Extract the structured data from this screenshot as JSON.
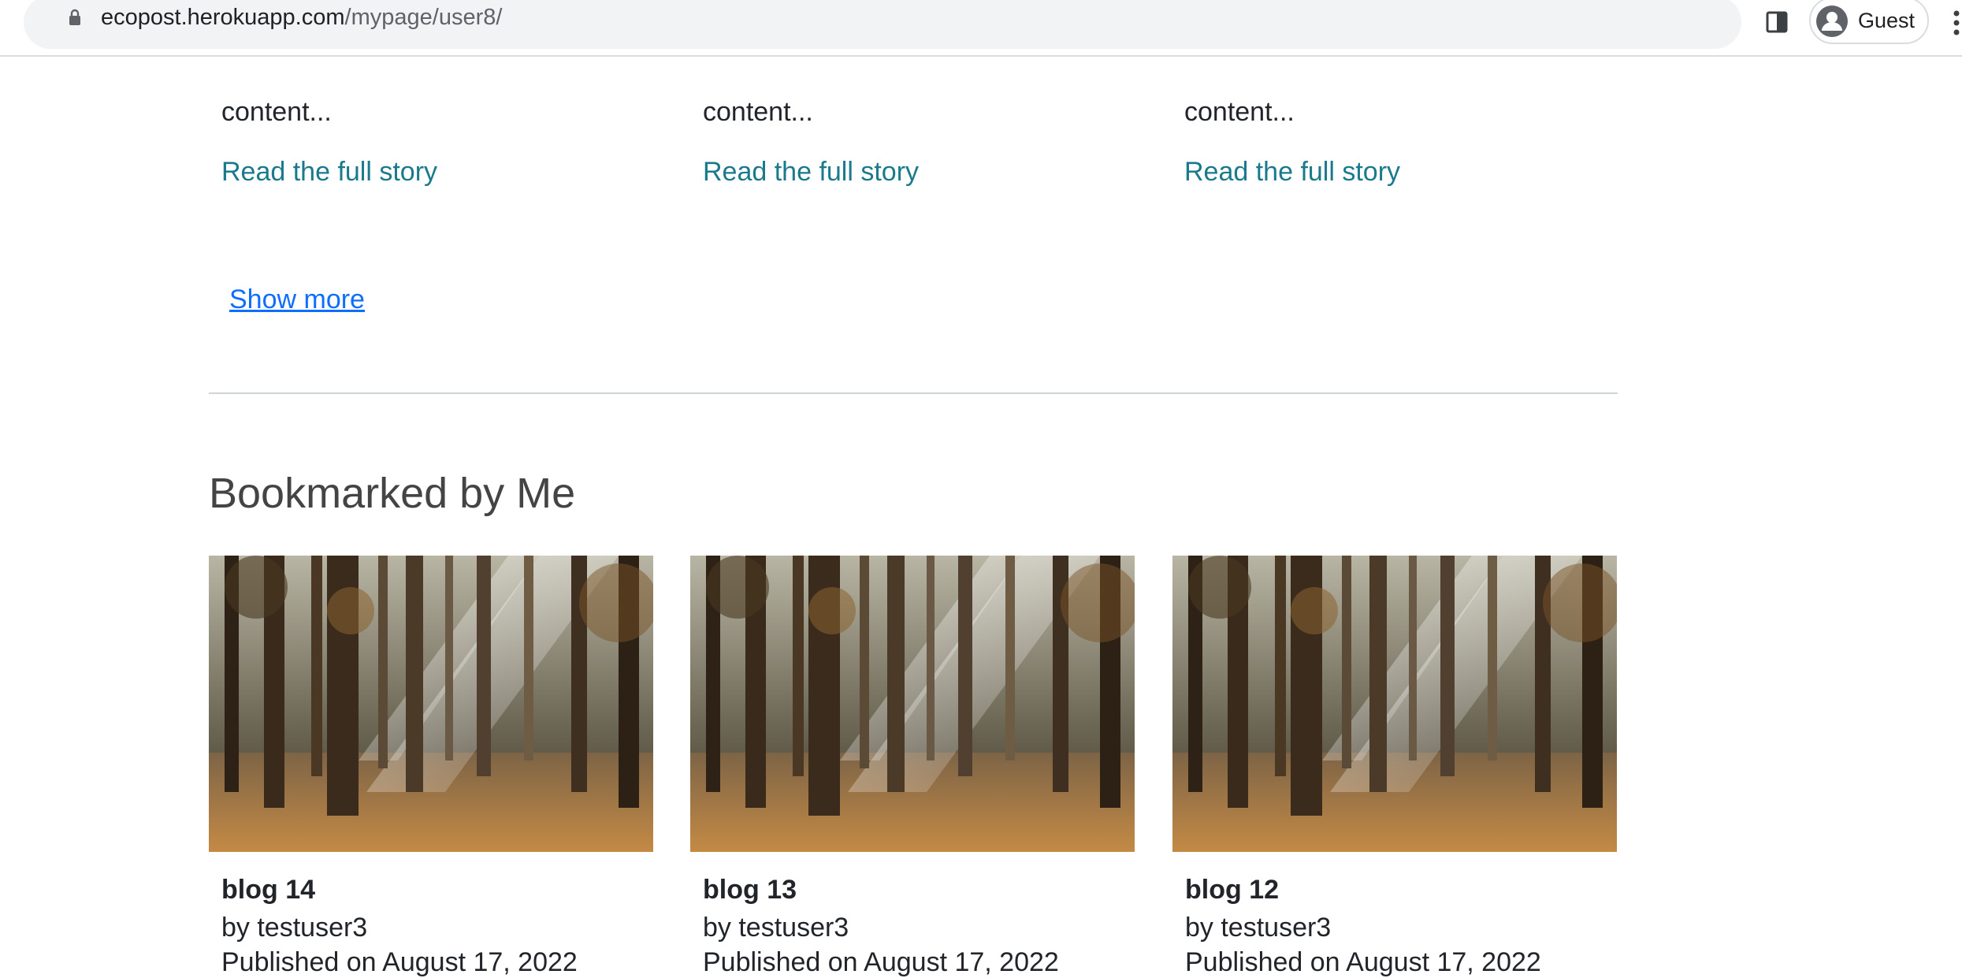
{
  "browser": {
    "url_host": "ecopost.herokuapp.com",
    "url_path": "/mypage/user8/",
    "profile_label": "Guest",
    "icons": [
      "lock-icon",
      "side-panel-icon",
      "avatar-icon",
      "kebab-menu-icon"
    ]
  },
  "top_cards": [
    {
      "text": "content...",
      "link": "Read the full story"
    },
    {
      "text": "content...",
      "link": "Read the full story"
    },
    {
      "text": "content...",
      "link": "Read the full story"
    }
  ],
  "show_more": "Show more",
  "bookmarked": {
    "title": "Bookmarked by Me",
    "cards": [
      {
        "title": "blog 14",
        "author": "by testuser3",
        "date": "Published on August 17, 2022"
      },
      {
        "title": "blog 13",
        "author": "by testuser3",
        "date": "Published on August 17, 2022"
      },
      {
        "title": "blog 12",
        "author": "by testuser3",
        "date": "Published on August 17, 2022"
      }
    ]
  },
  "colors": {
    "link": "#1a7a8c",
    "show_more": "#0d6efd",
    "heading": "#444444"
  }
}
